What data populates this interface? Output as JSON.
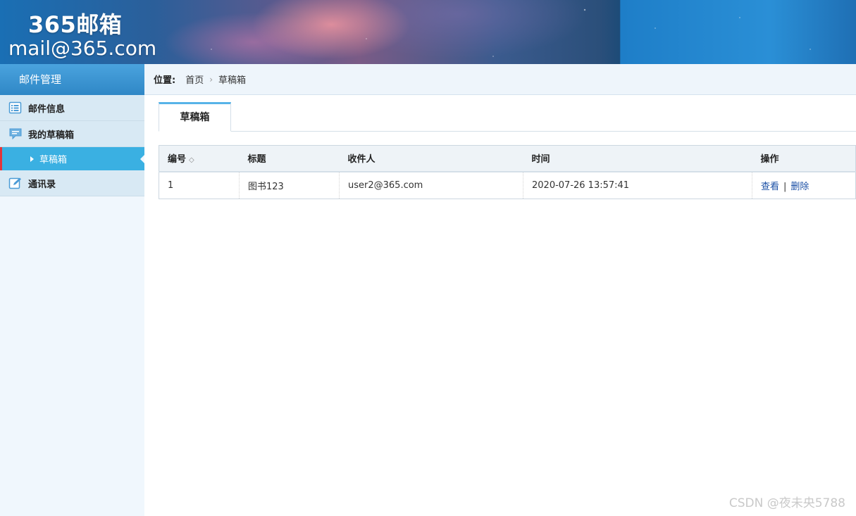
{
  "header": {
    "brand_cn": "365邮箱",
    "brand_en": "mail@365.com"
  },
  "sidebar": {
    "title": "邮件管理",
    "items": [
      {
        "label": "邮件信息",
        "icon": "list-icon"
      },
      {
        "label": "我的草稿箱",
        "icon": "chat-bubble-icon"
      },
      {
        "label": "草稿箱",
        "icon": "caret-right-icon",
        "active": true
      },
      {
        "label": "通讯录",
        "icon": "edit-icon"
      }
    ]
  },
  "breadcrumb": {
    "label": "位置:",
    "home": "首页",
    "separator": "›",
    "current": "草稿箱"
  },
  "tabs": [
    {
      "label": "草稿箱",
      "active": true
    }
  ],
  "table": {
    "columns": [
      "编号",
      "标题",
      "收件人",
      "时间",
      "操作"
    ],
    "sort_icon": "◇",
    "rows": [
      {
        "id": "1",
        "title": "图书123",
        "recipient": "user2@365.com",
        "time": "2020-07-26 13:57:41",
        "actions": {
          "view": "查看",
          "sep": "|",
          "delete": "删除"
        }
      }
    ]
  },
  "watermark": "CSDN @夜未央5788",
  "colors": {
    "accent": "#3ab0e2",
    "active_marker": "#e3343a",
    "link": "#1a4fa5",
    "tab_top": "#57b3e8"
  }
}
